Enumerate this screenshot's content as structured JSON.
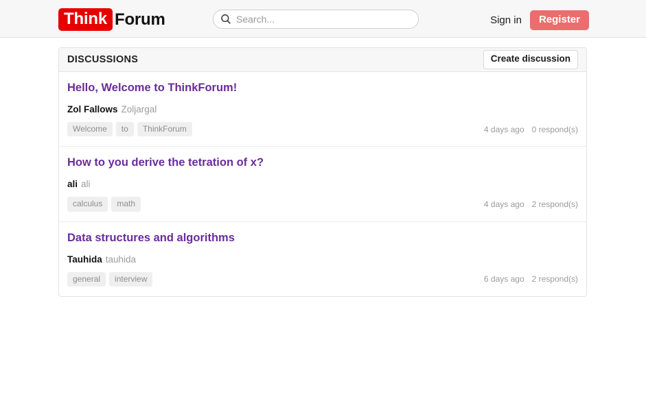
{
  "navbar": {
    "brand_mark": "Think",
    "brand_rest": "Forum",
    "brand_mark_color": "#e60000",
    "search": {
      "icon": "search-icon",
      "placeholder": "Search...",
      "value": ""
    },
    "signin_label": "Sign in",
    "register_label": "Register",
    "register_color": "#ec6d6d"
  },
  "card": {
    "header_title": "DISCUSSIONS",
    "create_label": "Create discussion",
    "title_color": "#6a2c9c",
    "discussions": [
      {
        "title": "Hello, Welcome to ThinkForum!",
        "author": "Zol Fallows",
        "username": "Zoljargal",
        "tags": [
          "Welcome",
          "to",
          "ThinkForum"
        ],
        "time": "4 days ago",
        "responds": "0 respond(s)"
      },
      {
        "title": "How to you derive the tetration of x?",
        "author": "ali",
        "username": "ali",
        "tags": [
          "calculus",
          "math"
        ],
        "time": "4 days ago",
        "responds": "2 respond(s)"
      },
      {
        "title": "Data structures and algorithms",
        "author": "Tauhida",
        "username": "tauhida",
        "tags": [
          "general",
          "interview"
        ],
        "time": "6 days ago",
        "responds": "2 respond(s)"
      }
    ]
  }
}
